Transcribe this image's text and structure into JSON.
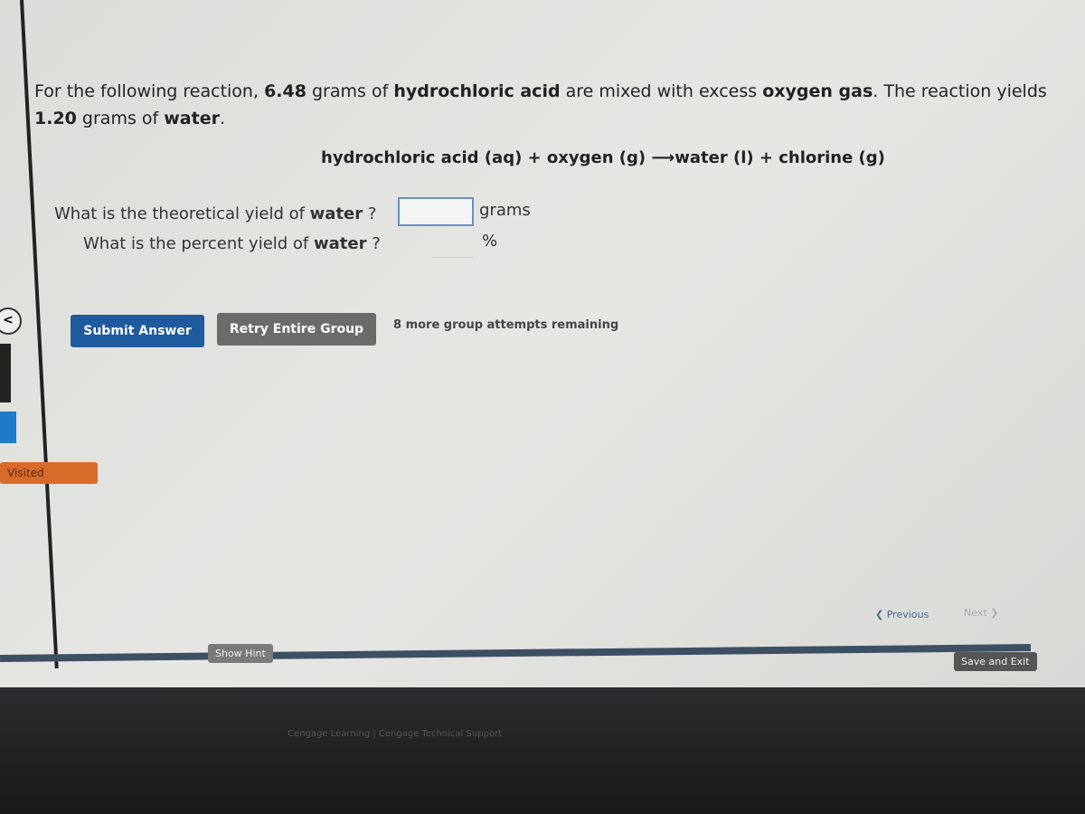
{
  "question": {
    "intro": "For the following reaction, ",
    "mass_acid": "6.48",
    "text2": " grams of ",
    "acid": "hydrochloric acid",
    "text3": " are mixed with excess ",
    "oxygen": "oxygen gas",
    "text4": ". The reaction yields ",
    "mass_water": "1.20",
    "text5": " grams of ",
    "water": "water",
    "end": "."
  },
  "equation": {
    "left": "hydrochloric acid (aq) + oxygen (g)",
    "arrow": "⟶",
    "right": "water (l) + chlorine (g)"
  },
  "q1": {
    "label": "What is the theoretical yield of ",
    "bold": "water",
    "end": " ?",
    "unit": "grams",
    "value": ""
  },
  "q2": {
    "label": "What is the percent yield of ",
    "bold": "water",
    "end": " ?",
    "unit": "%",
    "value": ""
  },
  "buttons": {
    "submit": "Submit Answer",
    "retry": "Retry Entire Group",
    "attempts": "8 more group attempts remaining",
    "hint": "Show Hint",
    "previous": "Previous",
    "next": "Next",
    "save_exit": "Save and Exit"
  },
  "sidebar": {
    "visited": "Visited",
    "collapse": "<"
  },
  "footer": {
    "text": "Cengage Learning | Cengage Technical Support"
  },
  "colors": {
    "submit": "#1f5a9e",
    "retry": "#6b6b6b",
    "visited": "#d86a2a"
  }
}
